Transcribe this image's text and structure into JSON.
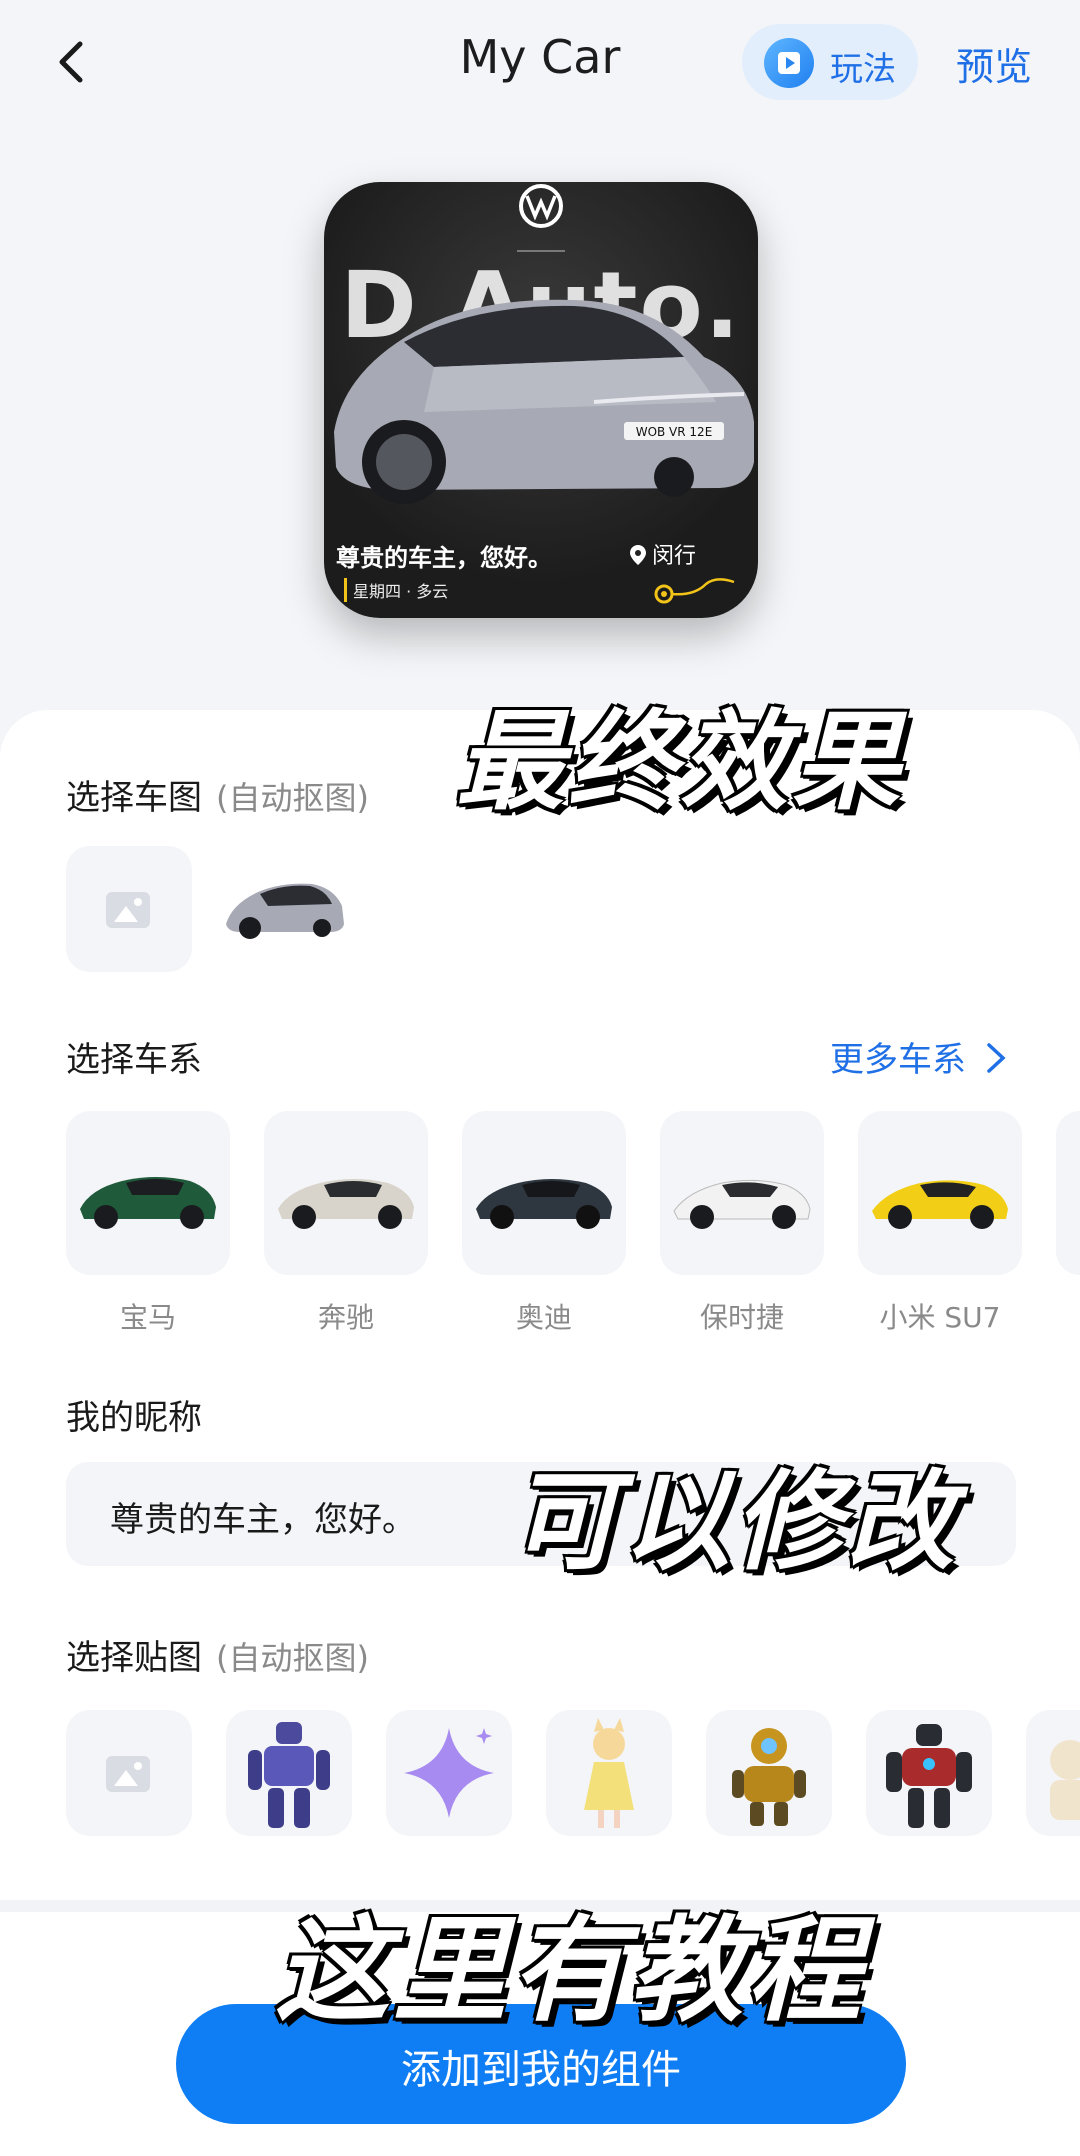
{
  "header": {
    "title": "My Car",
    "play_label": "玩法",
    "preview_label": "预览"
  },
  "widget": {
    "bg_word": "D Auto.",
    "greeting": "尊贵的车主，您好。",
    "location": "闵行",
    "weather": "星期四 · 多云",
    "plate": "WOB VR 12E"
  },
  "captions": {
    "final_effect": "最终效果",
    "editable": "可以修改",
    "tutorial": "这里有教程"
  },
  "car_image_section": {
    "title": "选择车图",
    "hint": "(自动抠图)"
  },
  "series_section": {
    "title": "选择车系",
    "more_label": "更多车系",
    "brands": [
      "宝马",
      "奔驰",
      "奥迪",
      "保时捷",
      "小米 SU7"
    ]
  },
  "nickname_section": {
    "title": "我的昵称",
    "value": "尊贵的车主，您好。"
  },
  "sticker_section": {
    "title": "选择贴图",
    "hint": "(自动抠图)"
  },
  "cta": {
    "label": "添加到我的组件"
  },
  "colors": {
    "accent": "#0f7ef4",
    "link": "#1f6fe6",
    "tile_bg": "#f3f5f8"
  },
  "icons": [
    "back-arrow-icon",
    "play-icon",
    "vw-logo-icon",
    "location-pin-icon",
    "image-placeholder-icon",
    "chevron-right-icon"
  ]
}
